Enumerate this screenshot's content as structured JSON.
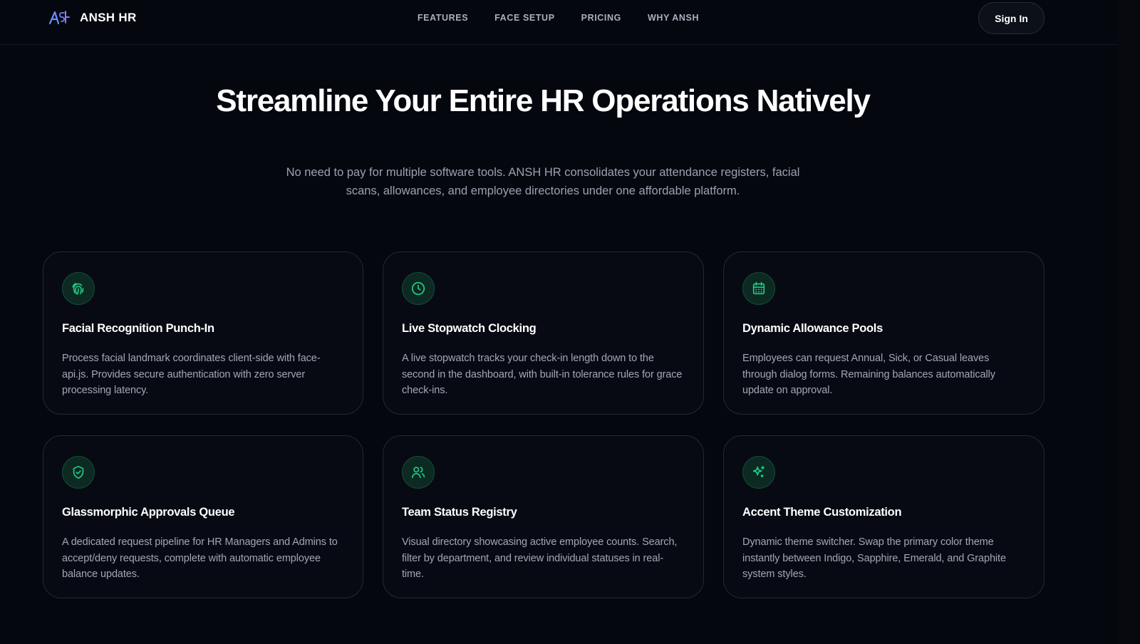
{
  "brand": {
    "name": "ANSH HR",
    "logo_icon": "ansh-logo-icon"
  },
  "nav": {
    "items": [
      {
        "label": "FEATURES"
      },
      {
        "label": "FACE SETUP"
      },
      {
        "label": "PRICING"
      },
      {
        "label": "WHY ANSH"
      }
    ],
    "signin_label": "Sign In"
  },
  "hero": {
    "title": "Streamline Your Entire HR Operations Natively",
    "subtitle": "No need to pay for multiple software tools. ANSH HR consolidates your attendance registers, facial scans, allowances, and employee directories under one affordable platform."
  },
  "features": [
    {
      "icon": "fingerprint-icon",
      "title": "Facial Recognition Punch-In",
      "description": "Process facial landmark coordinates client-side with face-api.js. Provides secure authentication with zero server processing latency."
    },
    {
      "icon": "clock-icon",
      "title": "Live Stopwatch Clocking",
      "description": "A live stopwatch tracks your check-in length down to the second in the dashboard, with built-in tolerance rules for grace check-ins."
    },
    {
      "icon": "calendar-icon",
      "title": "Dynamic Allowance Pools",
      "description": "Employees can request Annual, Sick, or Casual leaves through dialog forms. Remaining balances automatically update on approval."
    },
    {
      "icon": "shield-check-icon",
      "title": "Glassmorphic Approvals Queue",
      "description": "A dedicated request pipeline for HR Managers and Admins to accept/deny requests, complete with automatic employee balance updates."
    },
    {
      "icon": "users-icon",
      "title": "Team Status Registry",
      "description": "Visual directory showcasing active employee counts. Search, filter by department, and review individual statuses in real-time."
    },
    {
      "icon": "sparkles-icon",
      "title": "Accent Theme Customization",
      "description": "Dynamic theme switcher. Swap the primary color theme instantly between Indigo, Sapphire, Emerald, and Graphite system styles."
    }
  ],
  "colors": {
    "background": "#05070e",
    "accent": "#22c98a",
    "card_border": "#222833"
  }
}
